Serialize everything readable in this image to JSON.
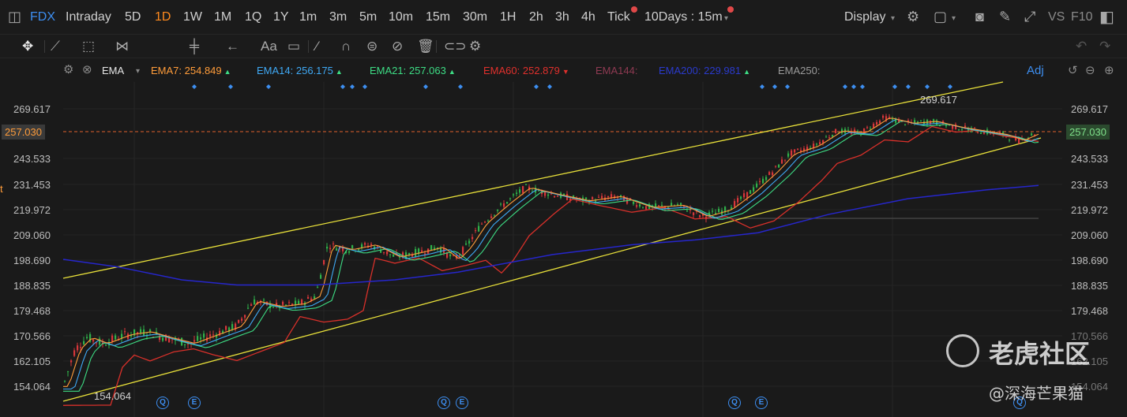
{
  "topbar": {
    "ticker": "FDX",
    "periods": [
      "Intraday",
      "5D",
      "1D",
      "1W",
      "1M",
      "1Q",
      "1Y",
      "1m",
      "3m",
      "5m",
      "10m",
      "15m",
      "30m",
      "1H",
      "2h",
      "3h",
      "4h",
      "Tick"
    ],
    "active_period": "1D",
    "range_selector": "10Days : 15m",
    "display_label": "Display",
    "vs_label": "VS",
    "f10_label": "F10"
  },
  "legend": {
    "indicator": "EMA",
    "items": [
      {
        "label": "EMA7:",
        "value": "254.849",
        "trend": "up",
        "color": "#ff9c3a"
      },
      {
        "label": "EMA14:",
        "value": "256.175",
        "trend": "up",
        "color": "#3fa9f5"
      },
      {
        "label": "EMA21:",
        "value": "257.063",
        "trend": "up",
        "color": "#3ddc84"
      },
      {
        "label": "EMA60:",
        "value": "252.879",
        "trend": "down",
        "color": "#e0302c"
      },
      {
        "label": "EMA144:",
        "value": "",
        "trend": "",
        "color": "#8e3a52"
      },
      {
        "label": "EMA200:",
        "value": "229.981",
        "trend": "up",
        "color": "#2222cc"
      },
      {
        "label": "EMA250:",
        "value": "",
        "trend": "",
        "color": "#9a9a9a"
      }
    ],
    "adj_label": "Adj"
  },
  "axis": {
    "left_labels": [
      "269.617",
      "243.533",
      "231.453",
      "219.972",
      "209.060",
      "198.690",
      "188.835",
      "179.468",
      "170.566",
      "162.105",
      "154.064"
    ],
    "right_labels": [
      "269.617",
      "243.533",
      "231.453",
      "219.972",
      "209.060",
      "198.690",
      "188.835",
      "179.468",
      "170.566",
      "162.105",
      "154.064"
    ],
    "current_price": "257.030",
    "left_partial_glyph": "t"
  },
  "annotations": {
    "high_label": "269.617",
    "low_label": "154.064",
    "event_badges": [
      "Q",
      "E",
      "Q",
      "E",
      "Q",
      "E",
      "Q"
    ]
  },
  "watermark": {
    "brand": "老虎社区",
    "author": "@深海芒果猫"
  }
}
